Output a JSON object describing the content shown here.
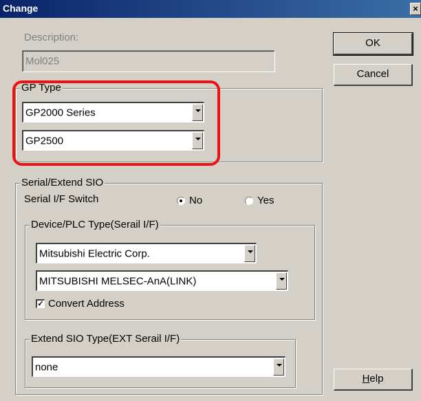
{
  "window": {
    "title": "Change",
    "close_glyph": "×"
  },
  "description": {
    "label": "Description:",
    "value": "Mol025"
  },
  "gp_type": {
    "legend": "GP Type",
    "series_value": "GP2000 Series",
    "model_value": "GP2500"
  },
  "serial": {
    "legend": "Serial/Extend SIO",
    "switch_label": "Serial I/F Switch",
    "option_no": "No",
    "option_yes": "Yes",
    "selected": "No",
    "device": {
      "legend": "Device/PLC Type(Serail I/F)",
      "maker_value": "Mitsubishi Electric Corp.",
      "type_value": "MITSUBISHI MELSEC-AnA(LINK)",
      "convert_label": "Convert Address",
      "convert_checked": true
    },
    "extend": {
      "legend": "Extend SIO Type(EXT Serail I/F)",
      "value": "none"
    }
  },
  "buttons": {
    "ok": "OK",
    "cancel": "Cancel",
    "help_accel": "H",
    "help_rest": "elp"
  },
  "colors": {
    "highlight": "#ee1111",
    "titlebar": "#0a246a",
    "dialog_bg": "#d4d0c8"
  }
}
